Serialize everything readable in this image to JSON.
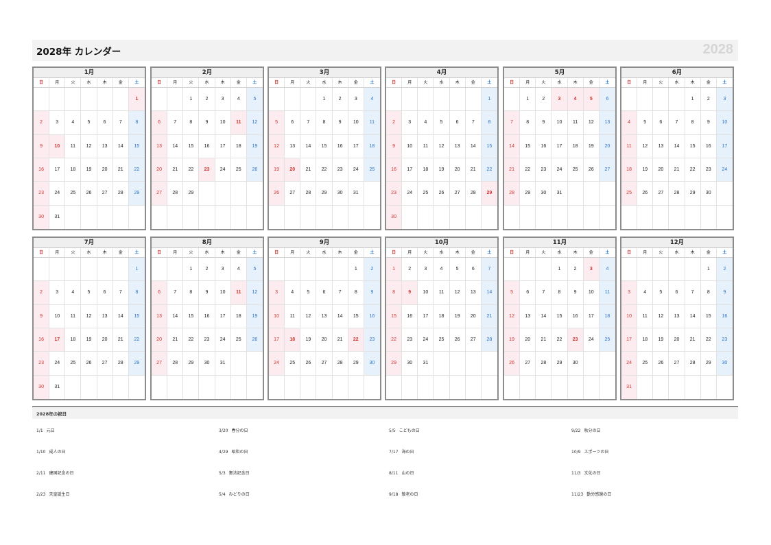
{
  "title": "2028年 カレンダー",
  "year_mark": "2028",
  "weekday_labels": [
    "日",
    "月",
    "火",
    "水",
    "木",
    "金",
    "土"
  ],
  "months": [
    {
      "name": "1月",
      "first_dow": 6,
      "days": 31,
      "holidays": [
        1,
        10
      ]
    },
    {
      "name": "2月",
      "first_dow": 2,
      "days": 29,
      "holidays": [
        11,
        23
      ]
    },
    {
      "name": "3月",
      "first_dow": 3,
      "days": 31,
      "holidays": [
        20
      ]
    },
    {
      "name": "4月",
      "first_dow": 6,
      "days": 30,
      "holidays": [
        29
      ]
    },
    {
      "name": "5月",
      "first_dow": 1,
      "days": 31,
      "holidays": [
        3,
        4,
        5
      ]
    },
    {
      "name": "6月",
      "first_dow": 4,
      "days": 30,
      "holidays": []
    },
    {
      "name": "7月",
      "first_dow": 6,
      "days": 31,
      "holidays": [
        17
      ]
    },
    {
      "name": "8月",
      "first_dow": 2,
      "days": 31,
      "holidays": [
        11
      ]
    },
    {
      "name": "9月",
      "first_dow": 5,
      "days": 30,
      "holidays": [
        18,
        22
      ]
    },
    {
      "name": "10月",
      "first_dow": 0,
      "days": 31,
      "holidays": [
        9
      ]
    },
    {
      "name": "11月",
      "first_dow": 3,
      "days": 30,
      "holidays": [
        3,
        23
      ]
    },
    {
      "name": "12月",
      "first_dow": 5,
      "days": 31,
      "holidays": []
    }
  ],
  "holidays_title": "2028年の祝日",
  "holiday_columns": [
    [
      {
        "date": "1/1",
        "name": "元日"
      },
      {
        "date": "1/10",
        "name": "成人の日"
      },
      {
        "date": "2/11",
        "name": "建国記念の日"
      },
      {
        "date": "2/23",
        "name": "天皇誕生日"
      }
    ],
    [
      {
        "date": "3/20",
        "name": "春分の日"
      },
      {
        "date": "4/29",
        "name": "昭和の日"
      },
      {
        "date": "5/3",
        "name": "憲法記念日"
      },
      {
        "date": "5/4",
        "name": "みどりの日"
      }
    ],
    [
      {
        "date": "5/5",
        "name": "こどもの日"
      },
      {
        "date": "7/17",
        "name": "海の日"
      },
      {
        "date": "8/11",
        "name": "山の日"
      },
      {
        "date": "9/18",
        "name": "敬老の日"
      }
    ],
    [
      {
        "date": "9/22",
        "name": "秋分の日"
      },
      {
        "date": "10/9",
        "name": "スポーツの日"
      },
      {
        "date": "11/3",
        "name": "文化の日"
      },
      {
        "date": "11/23",
        "name": "勤労感謝の日"
      }
    ]
  ],
  "colors": {
    "sunday": "#d1332e",
    "saturday": "#2a74c9",
    "holiday_bg": "#fdecef",
    "saturday_bg": "#e6f1fb"
  }
}
